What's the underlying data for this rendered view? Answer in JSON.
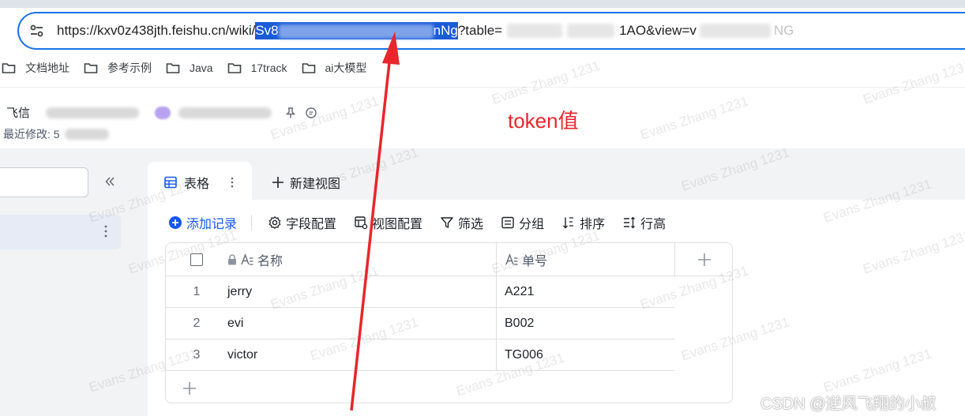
{
  "browser": {
    "url_prefix": "https://kxv0z438jth.feishu.cn/wiki/",
    "url_selected": "Sv8",
    "url_selected_tail": "nNg",
    "url_query_1": "?table=",
    "url_query_2": "1AO&view=v",
    "url_query_3": "NG"
  },
  "bookmarks": [
    {
      "label": "文档地址"
    },
    {
      "label": "参考示例"
    },
    {
      "label": "Java"
    },
    {
      "label": "17track"
    },
    {
      "label": "ai大模型"
    }
  ],
  "document": {
    "title_prefix": "飞信",
    "modified_label": "最近修改: 5"
  },
  "annotation": {
    "text": "token值",
    "color": "#e8262b"
  },
  "tabs": {
    "active_label": "表格",
    "new_view_label": "新建视图"
  },
  "toolbar": {
    "add_record": "添加记录",
    "field_config": "字段配置",
    "view_config": "视图配置",
    "filter": "筛选",
    "group": "分组",
    "sort": "排序",
    "row_height": "行高"
  },
  "table": {
    "columns": [
      "名称",
      "单号"
    ],
    "rows": [
      {
        "index": "1",
        "name": "jerry",
        "code": "A221"
      },
      {
        "index": "2",
        "name": "evi",
        "code": "B002"
      },
      {
        "index": "3",
        "name": "victor",
        "code": "TG006"
      }
    ]
  },
  "watermark": {
    "text": "Evans Zhang 1231"
  },
  "footer": {
    "csdn": "CSDN @逆风飞翔的小叔"
  },
  "colors": {
    "accent": "#1456f0",
    "url_focus": "#1a73e8",
    "selection": "#1a5bd8"
  }
}
